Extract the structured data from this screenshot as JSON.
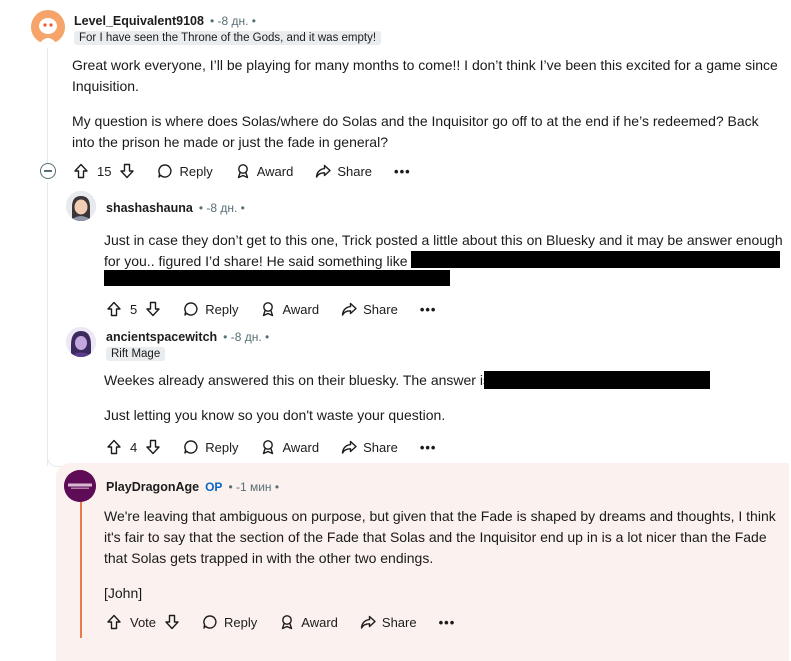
{
  "comments": [
    {
      "username": "Level_Equivalent9108",
      "meta": "• -8 дн. •",
      "flair": "For I have seen the Throne of the Gods, and it was empty!",
      "body1": "Great work everyone, I’ll be playing for many months to come!! I don’t think I’ve been this excited for a game since",
      "body1b": "Inquisition.",
      "body2": "My question is  where does Solas/where do Solas and the Inquisitor go off to at the end if he’s redeemed? Back",
      "body2b": "into the prison he made or just the fade in general?",
      "votes": "15"
    },
    {
      "username": "shashashauna",
      "meta": "• -8 дн. •",
      "body1": "Just in case they don’t get to this one, Trick posted a little about this on Bluesky and it may be answer enough",
      "body1b": "for you.. figured I’d share! He said something like",
      "votes": "5"
    },
    {
      "username": "ancientspacewitch",
      "meta": "• -8 дн. •",
      "flair": "Rift Mage",
      "body1": "Weekes already answered this on their bluesky. The answer is",
      "body2": "Just letting you know so you don't waste your question.",
      "votes": "4"
    },
    {
      "username": "PlayDragonAge",
      "op": "OP",
      "meta": "• -1 мин •",
      "body1": "We're leaving that ambiguous on purpose, but given that the Fade is shaped by dreams and thoughts, I think",
      "body1b": "it's fair to say that the section of the Fade that Solas and the Inquisitor end up in is a lot nicer than the Fade",
      "body1c": "that Solas gets trapped in with the other two endings.",
      "body2": "[John]",
      "votes": "Vote"
    }
  ],
  "actions": {
    "reply": "Reply",
    "award": "Award",
    "share": "Share",
    "more": "•••"
  },
  "colors": {
    "highlight_bg": "#fbf1ee",
    "highlight_border": "#ea7a4c",
    "op": "#0a66c2"
  },
  "icons": [
    "upvote-icon",
    "downvote-icon",
    "reply-icon",
    "award-icon",
    "share-icon",
    "more-icon",
    "collapse-icon"
  ]
}
